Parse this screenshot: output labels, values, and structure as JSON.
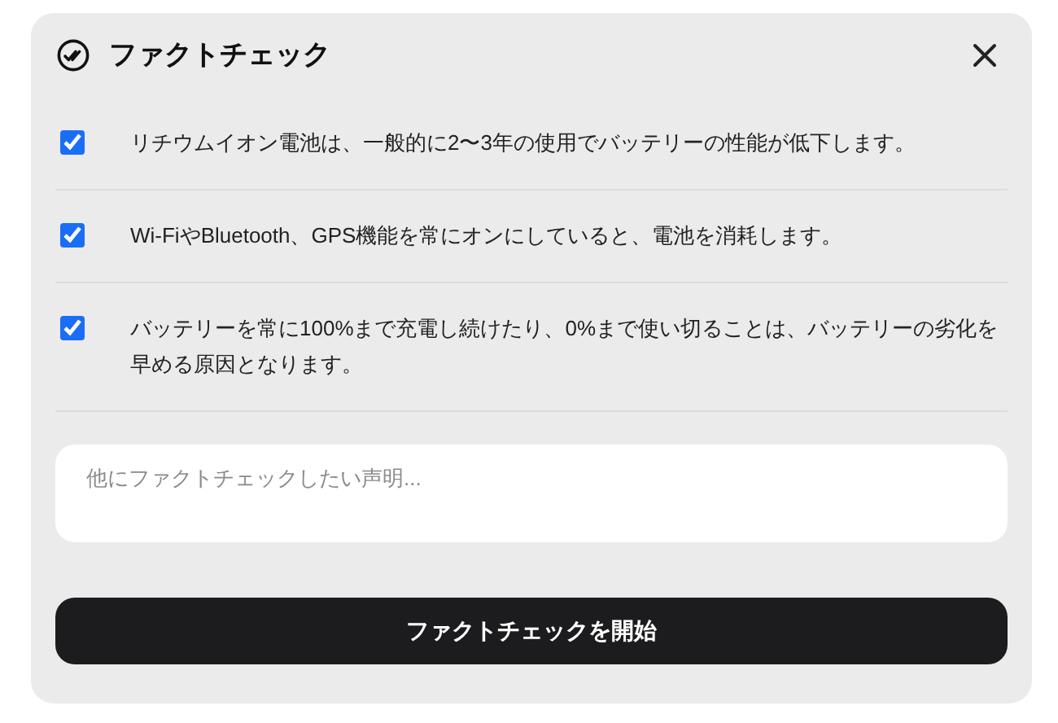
{
  "dialog": {
    "title": "ファクトチェック"
  },
  "claims": [
    {
      "text": "リチウムイオン電池は、一般的に2〜3年の使用でバッテリーの性能が低下します。",
      "checked": true
    },
    {
      "text": "Wi-FiやBluetooth、GPS機能を常にオンにしていると、電池を消耗します。",
      "checked": true
    },
    {
      "text": "バッテリーを常に100%まで充電し続けたり、0%まで使い切ることは、バッテリーの劣化を早める原因となります。",
      "checked": true
    }
  ],
  "input": {
    "placeholder": "他にファクトチェックしたい声明..."
  },
  "submit_button": "ファクトチェックを開始"
}
